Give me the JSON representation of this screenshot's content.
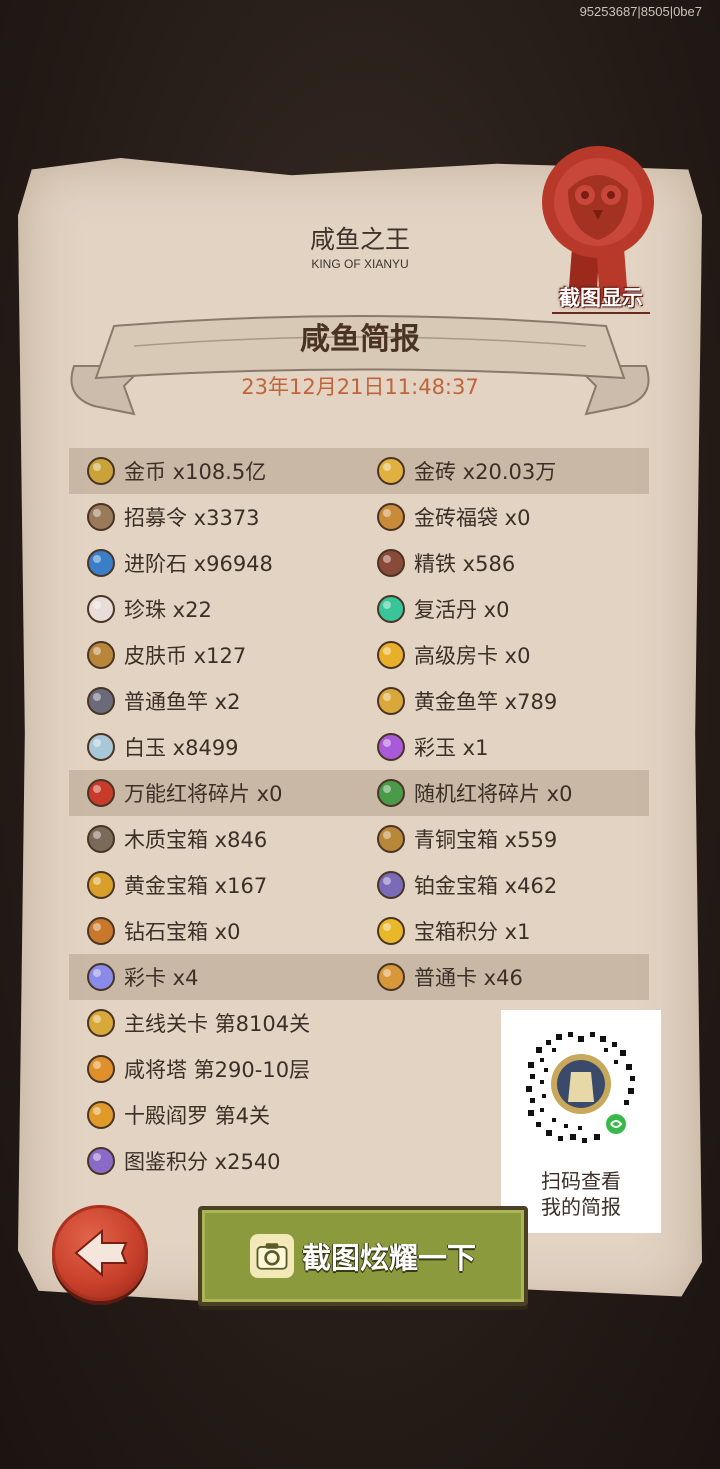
{
  "build_id": "95253687|8505|0be7",
  "header": {
    "title": "咸鱼之王",
    "subtitle": "KING OF XIANYU",
    "seal_label": "截图显示"
  },
  "report": {
    "title": "咸鱼简报",
    "datetime": "23年12月21日11:48:37"
  },
  "items": [
    {
      "label": "金币 x108.5亿",
      "icon": "gold-coin-icon",
      "color": "#c9a23a"
    },
    {
      "label": "金砖 x20.03万",
      "icon": "gold-brick-icon",
      "color": "#e0b040"
    },
    {
      "label": "招募令 x3373",
      "icon": "recruit-token-icon",
      "color": "#9a7a5a"
    },
    {
      "label": "金砖福袋 x0",
      "icon": "lucky-bag-icon",
      "color": "#c98a3a"
    },
    {
      "label": "进阶石 x96948",
      "icon": "advance-stone-icon",
      "color": "#3a7ec8"
    },
    {
      "label": "精铁 x586",
      "icon": "iron-ingot-icon",
      "color": "#8a4a3a"
    },
    {
      "label": "珍珠 x22",
      "icon": "pearl-icon",
      "color": "#e8ddd8"
    },
    {
      "label": "复活丹 x0",
      "icon": "revive-pill-icon",
      "color": "#3ac49a"
    },
    {
      "label": "皮肤币 x127",
      "icon": "skin-coin-icon",
      "color": "#b8863a"
    },
    {
      "label": "高级房卡 x0",
      "icon": "room-card-icon",
      "color": "#e8b02a"
    },
    {
      "label": "普通鱼竿 x2",
      "icon": "fishing-rod-icon",
      "color": "#6a6a7a"
    },
    {
      "label": "黄金鱼竿 x789",
      "icon": "gold-fishing-rod-icon",
      "color": "#d8a83a"
    },
    {
      "label": "白玉 x8499",
      "icon": "white-jade-icon",
      "color": "#a8c8d8"
    },
    {
      "label": "彩玉 x1",
      "icon": "color-jade-icon",
      "color": "#a85ad8"
    },
    {
      "label": "万能红将碎片 x0",
      "icon": "red-fragment-icon",
      "color": "#c83a2a"
    },
    {
      "label": "随机红将碎片 x0",
      "icon": "random-fragment-icon",
      "color": "#4a9a4a"
    },
    {
      "label": "木质宝箱 x846",
      "icon": "wooden-chest-icon",
      "color": "#7a6a5a"
    },
    {
      "label": "青铜宝箱 x559",
      "icon": "bronze-chest-icon",
      "color": "#b8883a"
    },
    {
      "label": "黄金宝箱 x167",
      "icon": "gold-chest-icon",
      "color": "#d8a02a"
    },
    {
      "label": "铂金宝箱 x462",
      "icon": "platinum-chest-icon",
      "color": "#7a6ab8"
    },
    {
      "label": "钻石宝箱 x0",
      "icon": "diamond-chest-icon",
      "color": "#c8782a"
    },
    {
      "label": "宝箱积分 x1",
      "icon": "chest-points-icon",
      "color": "#e8b82a"
    },
    {
      "label": "彩卡 x4",
      "icon": "color-card-icon",
      "color": "#8a8ae8"
    },
    {
      "label": "普通卡 x46",
      "icon": "normal-card-icon",
      "color": "#d8983a"
    },
    {
      "label": "主线关卡 第8104关",
      "icon": "main-stage-icon",
      "color": "#d8a83a"
    },
    {
      "label": "咸将塔 第290-10层",
      "icon": "tower-icon",
      "color": "#e0902a"
    },
    {
      "label": "十殿阎罗 第4关",
      "icon": "yama-icon",
      "color": "#e09a2a"
    },
    {
      "label": "图鉴积分 x2540",
      "icon": "codex-points-icon",
      "color": "#8a6ac8"
    }
  ],
  "qr": {
    "line1": "扫码查看",
    "line2": "我的简报"
  },
  "buttons": {
    "share_label": "截图炫耀一下"
  },
  "colors": {
    "paper": "#e2d3c3",
    "band": "#c8b8a6",
    "date": "#c0643a",
    "share_button": "#8c9a3e",
    "back_button": "#c8402b",
    "seal": "#b8392a"
  }
}
